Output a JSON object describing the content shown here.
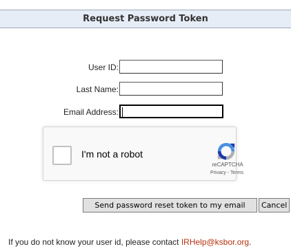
{
  "header": {
    "title": "Request Password Token"
  },
  "form": {
    "user_id_label": "User ID:",
    "last_name_label": "Last Name:",
    "email_label": "Email Address:",
    "user_id_value": "",
    "last_name_value": "",
    "email_value": ""
  },
  "captcha": {
    "checkbox_label": "I'm not a robot",
    "brand": "reCAPTCHA",
    "privacy": "Privacy",
    "separator": " - ",
    "terms": "Terms",
    "colors": {
      "blue": "#4a90e2",
      "dark_blue": "#1c3aa9",
      "gray": "#b0b0b0"
    }
  },
  "actions": {
    "send_label": "Send password reset token to my email",
    "cancel_label": "Cancel"
  },
  "footer": {
    "text": "If you do not know your user id, please contact ",
    "email_link": "IRHelp@ksbor.org",
    "suffix": "."
  }
}
